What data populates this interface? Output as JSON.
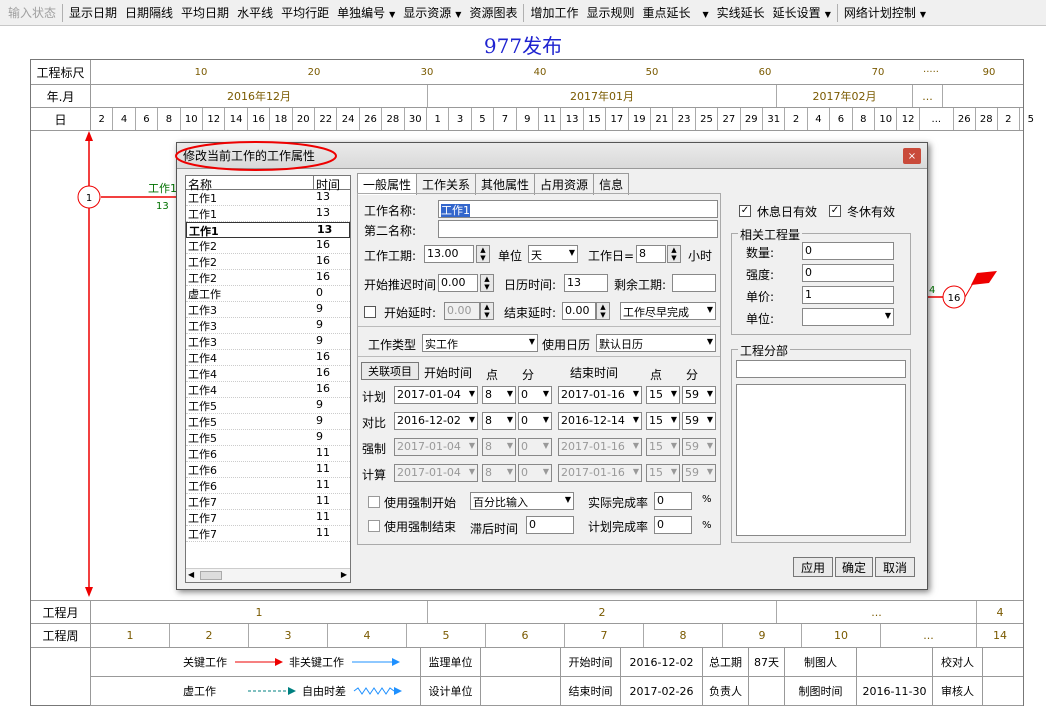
{
  "toolbar": {
    "items": [
      "输入状态",
      "显示日期",
      "日期隔线",
      "平均日期",
      "水平线",
      "平均行距",
      "单独编号",
      "显示资源",
      "资源图表",
      "增加工作",
      "显示规则",
      "重点延长",
      "实线延长",
      "延长设置",
      "网络计划控制"
    ]
  },
  "page_title": "977发布",
  "ruler": {
    "label_scale": "工程标尺",
    "label_month": "年.月",
    "label_day": "日",
    "scale_ticks": [
      "10",
      "20",
      "30",
      "40",
      "50",
      "60",
      "70",
      "·····",
      "90"
    ],
    "months": [
      "2016年12月",
      "2017年01月",
      "2017年02月",
      "..."
    ],
    "days": [
      "2",
      "4",
      "6",
      "8",
      "10",
      "12",
      "14",
      "16",
      "18",
      "20",
      "22",
      "24",
      "26",
      "28",
      "30",
      "1",
      "3",
      "5",
      "7",
      "9",
      "11",
      "13",
      "15",
      "17",
      "19",
      "21",
      "23",
      "25",
      "27",
      "29",
      "31",
      "2",
      "4",
      "6",
      "8",
      "10",
      "12",
      "...",
      "26",
      "28",
      "2",
      "5"
    ]
  },
  "network": {
    "node1": "1",
    "node16": "16",
    "label_left": "工作1",
    "label_left_num": "13",
    "label_right_num": "4"
  },
  "bottom": {
    "label_month": "工程月",
    "months": [
      "1",
      "2",
      "...",
      "4"
    ],
    "label_week": "工程周",
    "weeks": [
      "1",
      "2",
      "3",
      "4",
      "5",
      "6",
      "7",
      "8",
      "9",
      "10",
      "...",
      "14"
    ]
  },
  "legend": {
    "key_work": "关键工作",
    "nonkey_work": "非关键工作",
    "virtual_work": "虚工作",
    "free_float": "自由时差",
    "supervisor": "监理单位",
    "designer": "设计单位",
    "start_time_label": "开始时间",
    "start_time": "2016-12-02",
    "end_time_label": "结束时间",
    "end_time": "2017-02-26",
    "total_days_label": "总工期",
    "total_days": "87天",
    "owner_label": "负责人",
    "drawer_label": "制图人",
    "draw_time_label": "制图时间",
    "draw_time": "2016-11-30",
    "checker_label": "校对人",
    "reviewer_label": "审核人"
  },
  "dialog": {
    "title": "修改当前工作的工作属性",
    "close": "×",
    "list_header_name": "名称",
    "list_header_time": "时间",
    "list": [
      {
        "name": "工作1",
        "time": "13"
      },
      {
        "name": "工作1",
        "time": "13"
      },
      {
        "name": "工作1",
        "time": "13"
      },
      {
        "name": "工作2",
        "time": "16"
      },
      {
        "name": "工作2",
        "time": "16"
      },
      {
        "name": "工作2",
        "time": "16"
      },
      {
        "name": "虚工作",
        "time": "0"
      },
      {
        "name": "工作3",
        "time": "9"
      },
      {
        "name": "工作3",
        "time": "9"
      },
      {
        "name": "工作3",
        "time": "9"
      },
      {
        "name": "工作4",
        "time": "16"
      },
      {
        "name": "工作4",
        "time": "16"
      },
      {
        "name": "工作4",
        "time": "16"
      },
      {
        "name": "工作5",
        "time": "9"
      },
      {
        "name": "工作5",
        "time": "9"
      },
      {
        "name": "工作5",
        "time": "9"
      },
      {
        "name": "工作6",
        "time": "11"
      },
      {
        "name": "工作6",
        "time": "11"
      },
      {
        "name": "工作6",
        "time": "11"
      },
      {
        "name": "工作7",
        "time": "11"
      },
      {
        "name": "工作7",
        "time": "11"
      },
      {
        "name": "工作7",
        "time": "11"
      }
    ],
    "tabs": [
      "一般属性",
      "工作关系",
      "其他属性",
      "占用资源",
      "信息"
    ],
    "work_name_label": "工作名称:",
    "work_name": "工作1",
    "second_name_label": "第二名称:",
    "second_name": "",
    "duration_label": "工作工期:",
    "duration": "13.00",
    "unit_label": "单位",
    "unit": "天",
    "workday_label": "工作日=",
    "workday": "8",
    "hours_label": "小时",
    "start_delay_label": "开始推迟时间",
    "start_delay": "0.00",
    "calendar_time_label": "日历时间:",
    "calendar_time": "13",
    "remaining_label": "剩余工期:",
    "remaining": "",
    "start_lag_label": "开始延时:",
    "start_lag": "0.00",
    "end_lag_label": "结束延时:",
    "end_lag": "0.00",
    "schedule_mode": "工作尽早完成",
    "work_type_label": "工作类型",
    "work_type": "实工作",
    "calendar_label": "使用日历",
    "calendar": "默认日历",
    "linked_btn": "关联项目",
    "start_time_head": "开始时间",
    "point_head": "点",
    "minute_head": "分",
    "end_time_head": "结束时间",
    "rows": [
      {
        "label": "计划",
        "sd": "2017-01-04",
        "sh": "8",
        "sm": "0",
        "ed": "2017-01-16",
        "eh": "15",
        "em": "59"
      },
      {
        "label": "对比",
        "sd": "2016-12-02",
        "sh": "8",
        "sm": "0",
        "ed": "2016-12-14",
        "eh": "15",
        "em": "59"
      },
      {
        "label": "强制",
        "sd": "2017-01-04",
        "sh": "8",
        "sm": "0",
        "ed": "2017-01-16",
        "eh": "15",
        "em": "59"
      },
      {
        "label": "计算",
        "sd": "2017-01-04",
        "sh": "8",
        "sm": "0",
        "ed": "2017-01-16",
        "eh": "15",
        "em": "59"
      }
    ],
    "use_force_start": "使用强制开始",
    "input_mode": "百分比输入",
    "actual_rate_label": "实际完成率",
    "actual_rate": "0",
    "pct": "%",
    "use_force_end": "使用强制结束",
    "lag_time_label": "滞后时间",
    "lag_time": "0",
    "plan_rate_label": "计划完成率",
    "plan_rate": "0",
    "rest_valid": "休息日有效",
    "winter_valid": "冬休有效",
    "quantity_group": "相关工程量",
    "qty_label": "数量:",
    "qty": "0",
    "intensity_label": "强度:",
    "intensity": "0",
    "price_label": "单价:",
    "price": "1",
    "qunit_label": "单位:",
    "qunit": "",
    "division_group": "工程分部",
    "division": "",
    "apply": "应用",
    "ok": "确定",
    "cancel": "取消"
  }
}
